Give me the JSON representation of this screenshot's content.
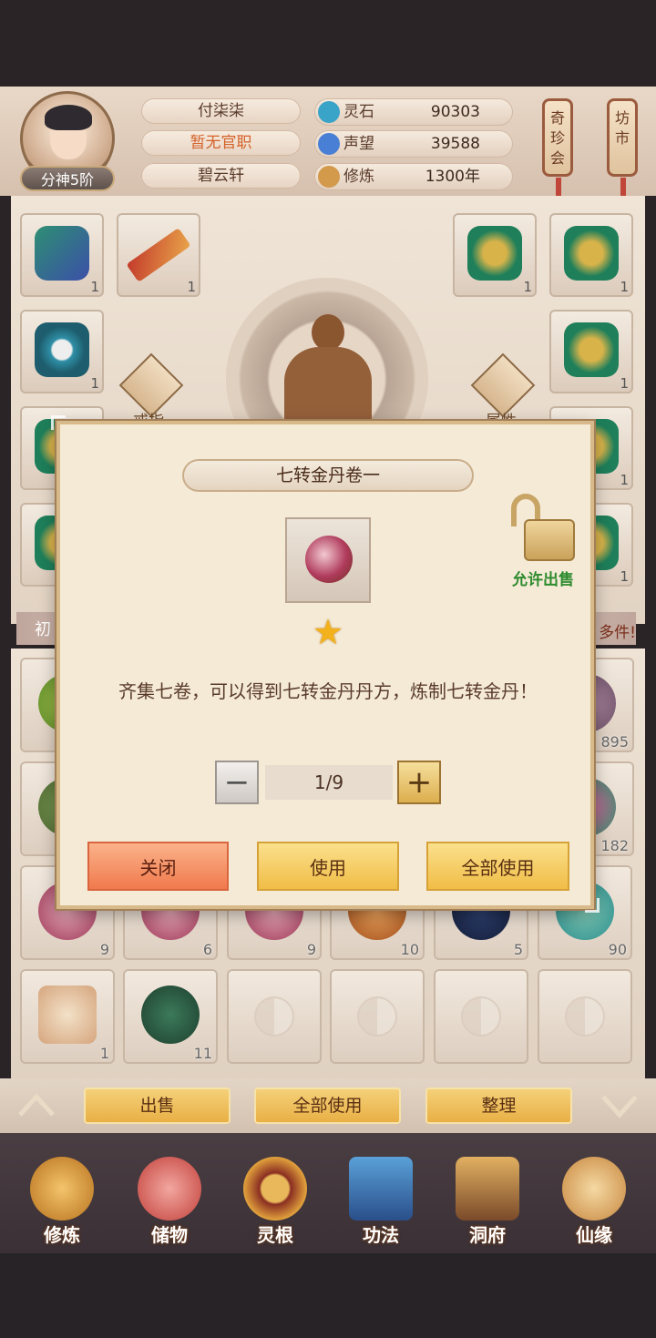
{
  "profile": {
    "name": "付柒柒",
    "official_rank": "暂无官职",
    "sect": "碧云轩",
    "realm_badge": "分神5阶"
  },
  "resources": [
    {
      "label": "灵石",
      "value": "90303",
      "icon": "spirit-stone-icon",
      "color": "#3aa3c8"
    },
    {
      "label": "声望",
      "value": "39588",
      "icon": "prestige-crystal-icon",
      "color": "#4a7fd6"
    },
    {
      "label": "修炼",
      "value": "1300年",
      "icon": "meditation-icon",
      "color": "#d29a4a"
    }
  ],
  "side_tags": {
    "treasure_shop": "奇珍会",
    "market": "坊市"
  },
  "equipment": {
    "ring_label": "戒指",
    "attributes_label": "属性",
    "slots": [
      {
        "qty": "1",
        "icon": "boots-icon"
      },
      {
        "qty": "1",
        "icon": "sword-icon"
      },
      {
        "qty": "1",
        "icon": "armor-icon"
      },
      {
        "qty": "1",
        "icon": "armor-icon"
      },
      {
        "qty": "1",
        "icon": "bracelet-icon"
      },
      {
        "qty": "1",
        "icon": "armor-icon"
      },
      {
        "qty": "1",
        "icon": "armor-icon"
      },
      {
        "qty": "1",
        "icon": "armor-icon"
      },
      {
        "qty": "1",
        "icon": "armor-icon"
      }
    ]
  },
  "bag": {
    "header_left": "初",
    "header_right": "多件!",
    "row_slots": [
      {
        "qty": "895"
      },
      {
        "qty": "182"
      },
      {
        "qty": "9"
      },
      {
        "qty": "6"
      },
      {
        "qty": "9"
      },
      {
        "qty": "10"
      },
      {
        "qty": "5"
      },
      {
        "qty": "90"
      },
      {
        "qty": "1"
      },
      {
        "qty": "11"
      }
    ]
  },
  "actions": {
    "sell": "出售",
    "use_all": "全部使用",
    "organize": "整理"
  },
  "nav": [
    {
      "label": "修炼",
      "icon": "cultivate-icon"
    },
    {
      "label": "储物",
      "icon": "storage-bag-icon"
    },
    {
      "label": "灵根",
      "icon": "spirit-root-icon"
    },
    {
      "label": "功法",
      "icon": "technique-book-icon"
    },
    {
      "label": "洞府",
      "icon": "cave-dwelling-icon"
    },
    {
      "label": "仙缘",
      "icon": "immortal-fate-icon"
    }
  ],
  "dialog": {
    "title": "七转金丹卷一",
    "stars": "★",
    "description": "齐集七卷，可以得到七转金丹丹方，炼制七转金丹！",
    "sell_permission": "允许出售",
    "quantity": "1/9",
    "minus": "−",
    "plus": "+",
    "close_label": "关闭",
    "use_label": "使用",
    "use_all_label": "全部使用"
  }
}
